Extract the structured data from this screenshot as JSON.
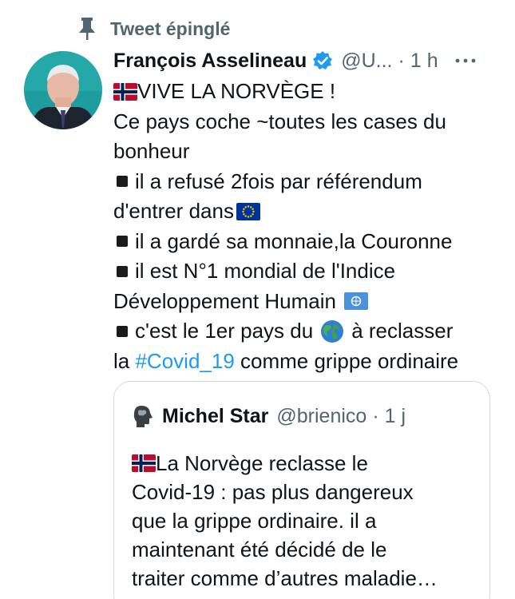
{
  "pinned_label": "Tweet épinglé",
  "tweet": {
    "author_name": "François Asselineau",
    "handle": "@U...",
    "time_sep": "·",
    "time": "1 h",
    "body": {
      "line1": "VIVE LA NORVÈGE !",
      "line2": "Ce pays coche ~toutes les cases du",
      "line3": "bonheur",
      "line4": "il a refusé 2fois par référendum",
      "line5": "d'entrer dans",
      "line6": "il a gardé sa monnaie,la Couronne",
      "line7": "il est N°1 mondial de l'Indice",
      "line8": "Développement Humain",
      "line9": "c'est le 1er pays du",
      "line9b": "à reclasser",
      "line10_pre": "la ",
      "hashtag": "#Covid_19",
      "line10_post": " comme grippe ordinaire"
    }
  },
  "quote": {
    "name": "Michel Star",
    "handle": "@brienico",
    "time_sep": "·",
    "time": "1 j",
    "body": {
      "line1": "La Norvège reclasse le",
      "line2": "Covid-19 : pas plus dangereux",
      "line3": "que la grippe ordinaire. il a",
      "line4": "maintenant été décidé de le",
      "line5": "traiter comme d’autres maladie…"
    }
  },
  "icons": [
    "pin-icon",
    "verified-icon",
    "more-icon",
    "norway-flag-icon",
    "eu-flag-icon",
    "un-flag-icon",
    "globe-icon",
    "bullet-square-icon",
    "quote-avatar-icon"
  ],
  "colors": {
    "text": "#0f1419",
    "secondary": "#536471",
    "link": "#1d9bf0",
    "border": "#cfd9de"
  }
}
